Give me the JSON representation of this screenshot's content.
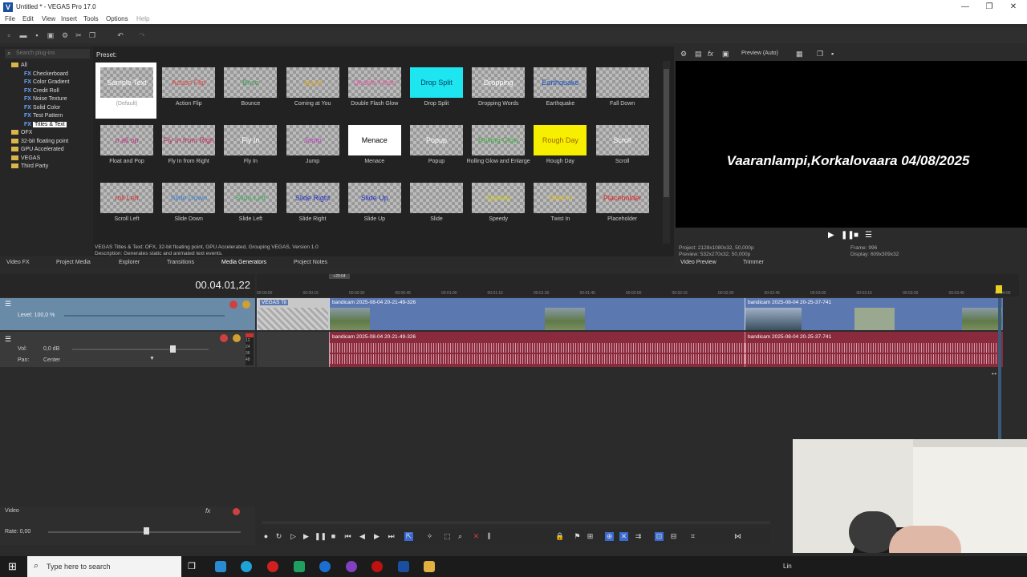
{
  "app": {
    "title": "Untitled * - VEGAS Pro 17.0",
    "logo": "V",
    "window_controls": [
      "—",
      "❐",
      "✕"
    ]
  },
  "menu": [
    "File",
    "Edit",
    "View",
    "Insert",
    "Tools",
    "Options",
    "Help"
  ],
  "toolbar_icons": [
    "new-file-icon",
    "open-folder-icon",
    "save-icon",
    "render-icon",
    "properties-icon",
    "cut-icon",
    "copy-icon",
    "undo-icon",
    "redo-icon"
  ],
  "plugins": {
    "search_placeholder": "Search plug-ins",
    "tree": [
      {
        "label": "All",
        "type": "folder"
      },
      {
        "label": "Checkerboard",
        "type": "fx"
      },
      {
        "label": "Color Gradient",
        "type": "fx"
      },
      {
        "label": "Credit Roll",
        "type": "fx"
      },
      {
        "label": "Noise Texture",
        "type": "fx"
      },
      {
        "label": "Solid Color",
        "type": "fx"
      },
      {
        "label": "Test Pattern",
        "type": "fx"
      },
      {
        "label": "Titles & Text",
        "type": "fx",
        "selected": true
      },
      {
        "label": "OFX",
        "type": "folder"
      },
      {
        "label": "32-bit floating point",
        "type": "folder"
      },
      {
        "label": "GPU Accelerated",
        "type": "folder"
      },
      {
        "label": "VEGAS",
        "type": "folder"
      },
      {
        "label": "Third Party",
        "type": "folder"
      }
    ]
  },
  "presets": {
    "header": "Preset:",
    "items": [
      {
        "name": "(Default)",
        "thumb": "Sample Text",
        "color": "#ffffff",
        "bg": "checker",
        "selected": true
      },
      {
        "name": "Action Flip",
        "thumb": "Action Flip",
        "color": "#e04848",
        "bg": "checker"
      },
      {
        "name": "Bounce",
        "thumb": "Bnce",
        "color": "#3aa050",
        "bg": "checker"
      },
      {
        "name": "Coming at You",
        "thumb": "ing at",
        "color": "#d9a520",
        "bg": "checker"
      },
      {
        "name": "Double Flash Glow",
        "thumb": "Double Flash",
        "color": "#e060a0",
        "bg": "checker"
      },
      {
        "name": "Drop Split",
        "thumb": "Drop Split",
        "color": "#004060",
        "bg": "#1ee6f0"
      },
      {
        "name": "Dropping Words",
        "thumb": "Dropping",
        "color": "#ffffff",
        "bg": "checker"
      },
      {
        "name": "Earthquake",
        "thumb": "Earthquake",
        "color": "#1a4fc0",
        "bg": "checker"
      },
      {
        "name": "Fall Down",
        "thumb": "· · ·",
        "color": "#40a060",
        "bg": "checker"
      },
      {
        "name": "Float and Pop",
        "thumb": "o  all  op",
        "color": "#c03080",
        "bg": "checker"
      },
      {
        "name": "Fly In from Right",
        "thumb": "Fly In from Righ",
        "color": "#c03060",
        "bg": "checker"
      },
      {
        "name": "Fly In",
        "thumb": "Fly In",
        "color": "#ffffff",
        "bg": "checker"
      },
      {
        "name": "Jump",
        "thumb": "Jump",
        "color": "#c040c0",
        "bg": "checker"
      },
      {
        "name": "Menace",
        "thumb": "Menace",
        "color": "#000000",
        "bg": "#ffffff"
      },
      {
        "name": "Popup",
        "thumb": "Popup",
        "color": "#ffffff",
        "bg": "checker"
      },
      {
        "name": "Rolling Glow and Enlarge",
        "thumb": "Rolling Glow",
        "color": "#40b040",
        "bg": "checker"
      },
      {
        "name": "Rough Day",
        "thumb": "Rough Day",
        "color": "#a06000",
        "bg": "#f6f000"
      },
      {
        "name": "Scroll",
        "thumb": "Scroll",
        "color": "#ffffff",
        "bg": "checker"
      },
      {
        "name": "Scroll Left",
        "thumb": "roll Left",
        "color": "#d03030",
        "bg": "checker"
      },
      {
        "name": "Slide Down",
        "thumb": "Slide Down",
        "color": "#4080d0",
        "bg": "checker"
      },
      {
        "name": "Slide Left",
        "thumb": "Slide Left",
        "color": "#40b060",
        "bg": "checker"
      },
      {
        "name": "Slide Right",
        "thumb": "Slide Right",
        "color": "#2030c0",
        "bg": "checker"
      },
      {
        "name": "Slide Up",
        "thumb": "Slide Up",
        "color": "#2030c0",
        "bg": "checker"
      },
      {
        "name": "Slide",
        "thumb": "",
        "color": "#ffffff",
        "bg": "checker"
      },
      {
        "name": "Speedy",
        "thumb": "Speedy",
        "color": "#d0d020",
        "bg": "checker"
      },
      {
        "name": "Twist In",
        "thumb": "Twist In",
        "color": "#e0c020",
        "bg": "checker"
      },
      {
        "name": "Placeholder",
        "thumb": "Placeholder",
        "color": "#e02020",
        "bg": "checker"
      }
    ],
    "description_line1": "VEGAS Titles & Text: OFX, 32-bit floating point, GPU Accelerated, Grouping VEGAS, Version 1.0",
    "description_line2": "Description: Generates static and animated text events."
  },
  "tabs_left": [
    "Video FX",
    "Project Media",
    "Explorer",
    "Transitions",
    "Media Generators",
    "Project Notes"
  ],
  "preview": {
    "mode_label": "Preview (Auto)",
    "caption": "Vaaranlampi,Korkalovaara 04/08/2025",
    "project_label": "Project:",
    "project_value": "2128x1080x32, 50,000p",
    "preview_label": "Preview:",
    "preview_value": "532x270x32, 50,000p",
    "frame_label": "Frame:",
    "frame_value": "996",
    "display_label": "Display:",
    "display_value": "609x309x32",
    "tabs": [
      "Video Preview",
      "Trimmer"
    ]
  },
  "timeline": {
    "timecode": "00.04.01,22",
    "marker_label": "+20:04",
    "ticks": [
      "00:00:00",
      "00:00:15",
      "00:00:30",
      "00:00:45",
      "00:01:00",
      "00:01:15",
      "00:01:30",
      "00:01:45",
      "00:02:00",
      "00:02:15",
      "00:02:30",
      "00:02:45",
      "00:03:00",
      "00:03:15",
      "00:03:30",
      "00:03:45",
      "00:04:00"
    ],
    "video_track": {
      "level_label": "Level: 100,0 %"
    },
    "audio_track": {
      "vol_label": "Vol:",
      "vol_value": "0,0 dB",
      "pan_label": "Pan:",
      "pan_value": "Center",
      "meter": [
        "12",
        "24",
        "36",
        "48"
      ]
    },
    "video_clips": [
      {
        "name": "VEGAS Tit"
      },
      {
        "name": "bandicam 2025-08-04 20-21-49-326"
      },
      {
        "name": "bandicam 2025-08-04 20-25-37-741"
      }
    ],
    "audio_clips": [
      {
        "name": "bandicam 2025-08-04 20-21-49-326"
      },
      {
        "name": "bandicam 2025-08-04 20-25-37-741"
      }
    ]
  },
  "bus": {
    "label": "Video",
    "rate_label": "Rate: 0,00"
  },
  "taskbar": {
    "search_placeholder": "Type here to search",
    "tray_text": "Lin"
  }
}
